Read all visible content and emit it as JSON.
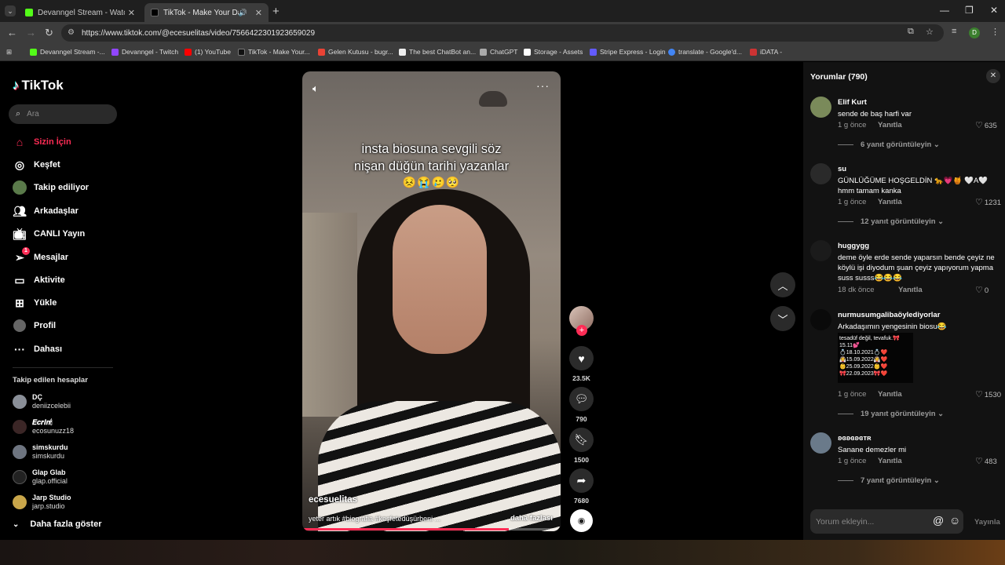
{
  "browser": {
    "tabs": [
      {
        "title": "Devanngel Stream - Watch Live",
        "active": false
      },
      {
        "title": "TikTok - Make Your Day",
        "active": true
      }
    ],
    "url": "https://www.tiktok.com/@ecesuelitas/video/7566422301923659029",
    "profile_initial": "D",
    "bookmarks": [
      "Devanngel Stream -...",
      "Devanngel - Twitch",
      "(1) YouTube",
      "TikTok - Make Your...",
      "Gelen Kutusu - bugr...",
      "The best ChatBot an...",
      "ChatGPT",
      "Storage - Assets",
      "Stripe Express - Login",
      "translate - Google'd...",
      "iDATA -"
    ]
  },
  "tiktok": {
    "logo": "TikTok",
    "search_placeholder": "Ara",
    "nav": [
      {
        "label": "Sizin İçin",
        "icon": "home-icon",
        "active": true
      },
      {
        "label": "Keşfet",
        "icon": "compass-icon"
      },
      {
        "label": "Takip ediliyor",
        "icon": "following-icon"
      },
      {
        "label": "Arkadaşlar",
        "icon": "friends-icon"
      },
      {
        "label": "CANLI Yayın",
        "icon": "live-icon"
      },
      {
        "label": "Mesajlar",
        "icon": "messages-icon",
        "badge": "1"
      },
      {
        "label": "Aktivite",
        "icon": "activity-icon"
      },
      {
        "label": "Yükle",
        "icon": "upload-icon"
      },
      {
        "label": "Profil",
        "icon": "profile-icon"
      },
      {
        "label": "Dahası",
        "icon": "more-icon"
      }
    ],
    "following_title": "Takip edilen hesaplar",
    "following": [
      {
        "name": "DÇ",
        "handle": "deniizcelebii"
      },
      {
        "name": "𝑬𝒄𝒓𝒊𝒏🕯",
        "handle": "ecosunuzz18"
      },
      {
        "name": "simskurdu",
        "handle": "simskurdu"
      },
      {
        "name": "Glap Glab",
        "handle": "glap.official"
      },
      {
        "name": "Jarp Studio",
        "handle": "jarp.studio"
      }
    ],
    "show_more": "Daha fazla göster"
  },
  "video": {
    "overlay_line1": "insta biosuna sevgili söz",
    "overlay_line2": "nişan düğün tarihi yazanlar",
    "overlay_emojis": "😣😭🥲🥺",
    "username": "ecesuelitas",
    "caption": "yeter artık #biografia #keşfetedüşürbeni ...",
    "more": "daha fazlası",
    "progress": 0.8,
    "likes": "23.5K",
    "comments": "790",
    "saves": "1500",
    "shares": "7680"
  },
  "comments_panel": {
    "title": "Yorumlar (790)",
    "reply_label": "Yanıtla",
    "input_placeholder": "Yorum ekleyin...",
    "post_label": "Yayınla",
    "comments": [
      {
        "user": "Elif Kurt",
        "text": "sende de baş harfi var",
        "time": "1 g önce",
        "likes": "635",
        "replies": "6 yanıt görüntüleyin"
      },
      {
        "user": "su",
        "text": "GÜNLÜĞÜME HOŞGELDİN 🐆💗🍯 🤍A🤍 hmm tamam kanka",
        "time": "1 g önce",
        "likes": "1231",
        "replies": "12 yanıt görüntüleyin"
      },
      {
        "user": "huggygg",
        "text": "deme öyle erde sende yaparsın bende çeyiz ne köylü işi diyodum şuan çeyiz yapıyorum yapma suss susss😂😂😂",
        "time": "18 dk önce",
        "likes": "0",
        "replies": ""
      },
      {
        "user": "nurmusumgalibaöylediyorlar",
        "text": "Arkadaşımın yengesinin biosu😂",
        "time": "1 g önce",
        "likes": "1530",
        "replies": "19 yanıt görüntüleyin",
        "image_lines": [
          "tesadüf değil, tevafuk.🎀",
          "15.11💕",
          "💍18.10.2021💍❤️",
          "👰15.09.2022👰❤️",
          "👶25.09.2022👶❤️",
          "🎀22.09.2023🎀❤️"
        ]
      },
      {
        "user": "ʚɞʚɞʚɞᴛʀ",
        "text": "Sanane demezler mi",
        "time": "1 g önce",
        "likes": "483",
        "replies": "7 yanıt görüntüleyin"
      }
    ]
  },
  "colors": {
    "accent": "#fe2c55",
    "panel": "#121212"
  }
}
